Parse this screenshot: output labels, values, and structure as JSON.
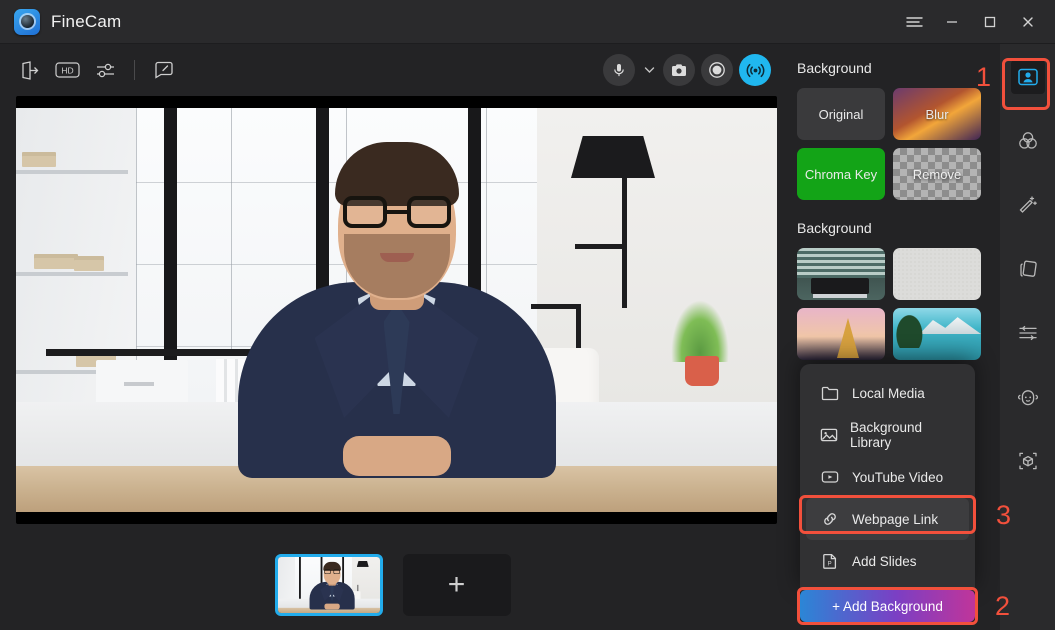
{
  "window": {
    "app_title": "FineCam",
    "logo_icon": "finecam-logo-icon",
    "controls": [
      {
        "name": "menu-button",
        "icon": "hamburger-menu-icon"
      },
      {
        "name": "minimize-button",
        "icon": "minimize-icon"
      },
      {
        "name": "maximize-button",
        "icon": "maximize-icon"
      },
      {
        "name": "close-button",
        "icon": "close-icon"
      }
    ]
  },
  "toolbar": {
    "left_items": [
      {
        "name": "virtual-camera-output-button",
        "icon": "export-door-icon"
      },
      {
        "name": "hd-quality-button",
        "icon": "hd-badge-icon",
        "label": "HD"
      },
      {
        "name": "settings-sliders-button",
        "icon": "sliders-icon"
      },
      {
        "name": "sticker-note-button",
        "icon": "note-pencil-icon"
      }
    ],
    "right_items": [
      {
        "name": "microphone-button",
        "icon": "microphone-icon"
      },
      {
        "name": "microphone-dropdown",
        "icon": "chevron-down-icon"
      },
      {
        "name": "snapshot-button",
        "icon": "camera-icon"
      },
      {
        "name": "record-button",
        "icon": "record-circle-icon"
      },
      {
        "name": "live-broadcast-button",
        "icon": "broadcast-icon",
        "active": true
      }
    ]
  },
  "preview": {
    "scene_description": "Man in navy suit with glasses seated at a wooden desk in a bright loft office"
  },
  "scenes": {
    "active_thumbnail": "scene-1",
    "add_label": "+"
  },
  "panel": {
    "background_title": "Background",
    "modes": [
      {
        "label": "Original",
        "name": "background-mode-original"
      },
      {
        "label": "Blur",
        "name": "background-mode-blur"
      },
      {
        "label": "Chroma Key",
        "name": "background-mode-chroma-key"
      },
      {
        "label": "Remove",
        "name": "background-mode-remove"
      }
    ],
    "library_title": "Background",
    "thumbnails": [
      {
        "name": "background-thumb-office-desk"
      },
      {
        "name": "background-thumb-white-wall"
      },
      {
        "name": "background-thumb-eiffel-tower"
      },
      {
        "name": "background-thumb-mountain-lake"
      }
    ],
    "add_background_label": "+ Add Background"
  },
  "menu": {
    "items": [
      {
        "label": "Local Media",
        "icon": "folder-icon",
        "name": "menu-item-local-media",
        "highlighted": false
      },
      {
        "label": "Background Library",
        "icon": "image-icon",
        "name": "menu-item-background-library",
        "highlighted": false
      },
      {
        "label": "YouTube Video",
        "icon": "play-video-icon",
        "name": "menu-item-youtube-video",
        "highlighted": false
      },
      {
        "label": "Webpage Link",
        "icon": "link-chain-icon",
        "name": "menu-item-webpage-link",
        "highlighted": true
      },
      {
        "label": "Add Slides",
        "icon": "powerpoint-file-icon",
        "name": "menu-item-add-slides",
        "highlighted": false
      }
    ]
  },
  "rail": {
    "items": [
      {
        "name": "rail-tab-background",
        "icon": "person-portrait-icon",
        "active": true
      },
      {
        "name": "rail-tab-color-filters",
        "icon": "color-circles-icon",
        "active": false
      },
      {
        "name": "rail-tab-beauty",
        "icon": "magic-wand-icon",
        "active": false
      },
      {
        "name": "rail-tab-layers",
        "icon": "layers-cards-icon",
        "active": false
      },
      {
        "name": "rail-tab-adjust",
        "icon": "adjust-sliders-icon",
        "active": false
      },
      {
        "name": "rail-tab-avatar",
        "icon": "face-avatar-icon",
        "active": false
      },
      {
        "name": "rail-tab-3d-object",
        "icon": "cube-frame-icon",
        "active": false
      }
    ]
  },
  "annotations": {
    "one": "1",
    "two": "2",
    "three": "3",
    "color": "#f2503c"
  }
}
